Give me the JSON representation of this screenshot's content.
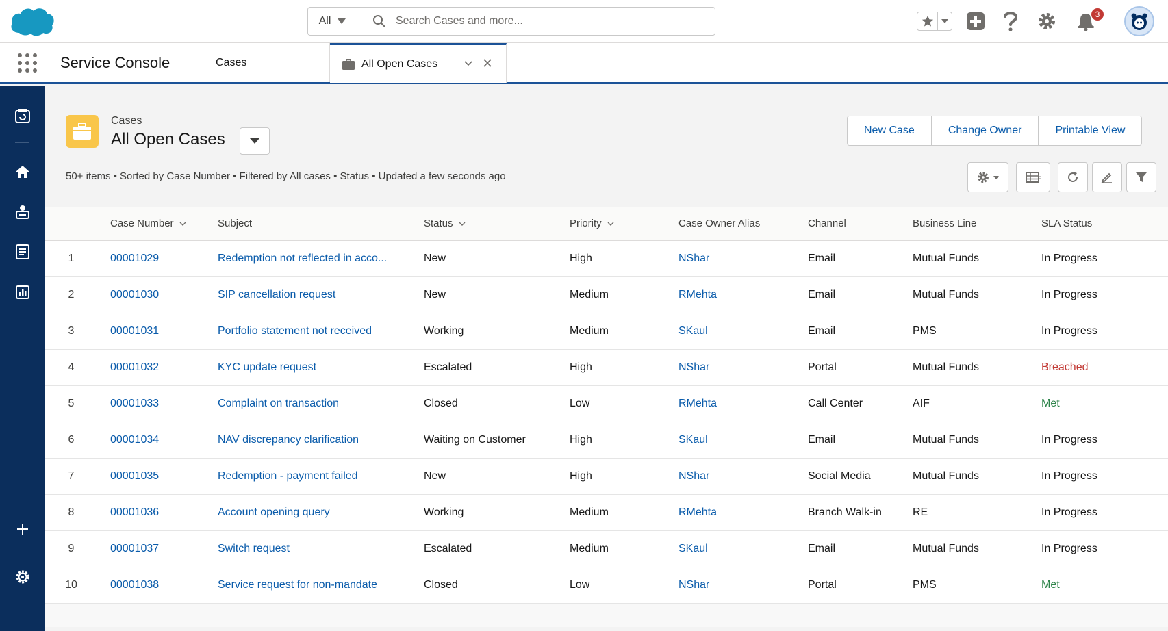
{
  "header": {
    "search_scope": "All",
    "search_placeholder": "Search Cases and more...",
    "notification_count": "3"
  },
  "navbar": {
    "app_name": "Service Console",
    "tabs": [
      {
        "label": "Cases"
      },
      {
        "label": "All Open Cases"
      }
    ]
  },
  "list": {
    "object_label": "Cases",
    "title": "All Open Cases",
    "meta": "50+ items • Sorted by Case Number • Filtered by All cases • Status • Updated a few seconds ago",
    "actions": {
      "new_case": "New Case",
      "change_owner": "Change Owner",
      "printable_view": "Printable View"
    }
  },
  "table": {
    "columns": [
      "Case Number",
      "Subject",
      "Status",
      "Priority",
      "Case Owner Alias",
      "Channel",
      "Business Line",
      "SLA Status"
    ],
    "rows": [
      {
        "num": "1",
        "case": "00001029",
        "subject": "Redemption not reflected in acco...",
        "status": "New",
        "priority": "High",
        "owner": "NShar",
        "channel": "Email",
        "line": "Mutual Funds",
        "sla": "In Progress"
      },
      {
        "num": "2",
        "case": "00001030",
        "subject": "SIP cancellation request",
        "status": "New",
        "priority": "Medium",
        "owner": "RMehta",
        "channel": "Email",
        "line": "Mutual Funds",
        "sla": "In Progress"
      },
      {
        "num": "3",
        "case": "00001031",
        "subject": "Portfolio statement not received",
        "status": "Working",
        "priority": "Medium",
        "owner": "SKaul",
        "channel": "Email",
        "line": "PMS",
        "sla": "In Progress"
      },
      {
        "num": "4",
        "case": "00001032",
        "subject": "KYC update request",
        "status": "Escalated",
        "priority": "High",
        "owner": "NShar",
        "channel": "Portal",
        "line": "Mutual Funds",
        "sla": "Breached"
      },
      {
        "num": "5",
        "case": "00001033",
        "subject": "Complaint on transaction",
        "status": "Closed",
        "priority": "Low",
        "owner": "RMehta",
        "channel": "Call Center",
        "line": "AIF",
        "sla": "Met"
      },
      {
        "num": "6",
        "case": "00001034",
        "subject": "NAV discrepancy clarification",
        "status": "Waiting on Customer",
        "priority": "High",
        "owner": "SKaul",
        "channel": "Email",
        "line": "Mutual Funds",
        "sla": "In Progress"
      },
      {
        "num": "7",
        "case": "00001035",
        "subject": "Redemption - payment failed",
        "status": "New",
        "priority": "High",
        "owner": "NShar",
        "channel": "Social Media",
        "line": "Mutual Funds",
        "sla": "In Progress"
      },
      {
        "num": "8",
        "case": "00001036",
        "subject": "Account opening query",
        "status": "Working",
        "priority": "Medium",
        "owner": "RMehta",
        "channel": "Branch Walk-in",
        "line": "RE",
        "sla": "In Progress"
      },
      {
        "num": "9",
        "case": "00001037",
        "subject": "Switch request",
        "status": "Escalated",
        "priority": "Medium",
        "owner": "SKaul",
        "channel": "Email",
        "line": "Mutual Funds",
        "sla": "In Progress"
      },
      {
        "num": "10",
        "case": "00001038",
        "subject": "Service request for non-mandate",
        "status": "Closed",
        "priority": "Low",
        "owner": "NShar",
        "channel": "Portal",
        "line": "PMS",
        "sla": "Met"
      }
    ]
  },
  "colors": {
    "brand_blue": "#1b5297",
    "sidebar": "#0b2e5c",
    "link": "#0b5cab",
    "breached": "#c23934",
    "met": "#2e844a",
    "cloud_logo": "#1798c1",
    "cases_icon": "#f9c64a"
  },
  "icons": {
    "logo": "salesforce-cloud-logo",
    "search": "search-icon",
    "favorites": "star-icon",
    "add": "plus-square-icon",
    "help": "question-icon",
    "setup": "gear-icon",
    "notifications": "bell-icon",
    "avatar": "astro-avatar-icon"
  }
}
